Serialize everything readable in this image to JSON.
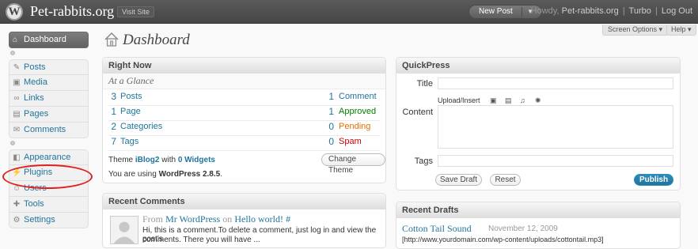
{
  "header": {
    "site_title": "Pet-rabbits.org",
    "visit_site": "Visit Site",
    "new_post": "New Post",
    "howdy": "Howdy,",
    "user": "Pet-rabbits.org",
    "turbo": "Turbo",
    "logout": "Log Out"
  },
  "screen_meta": {
    "screen_options": "Screen Options ▾",
    "help": "Help ▾"
  },
  "page_title": "Dashboard",
  "sidebar": {
    "dashboard": "Dashboard",
    "group1": [
      "Posts",
      "Media",
      "Links",
      "Pages",
      "Comments"
    ],
    "group2": [
      "Appearance",
      "Plugins",
      "Users",
      "Tools",
      "Settings"
    ]
  },
  "right_now": {
    "title": "Right Now",
    "subtitle": "At a Glance",
    "content": [
      {
        "num": "3",
        "label": "Posts"
      },
      {
        "num": "1",
        "label": "Page"
      },
      {
        "num": "2",
        "label": "Categories"
      },
      {
        "num": "7",
        "label": "Tags"
      }
    ],
    "discussion": [
      {
        "num": "1",
        "label": "Comment",
        "color": "#21759b"
      },
      {
        "num": "1",
        "label": "Approved",
        "color": "#008000"
      },
      {
        "num": "0",
        "label": "Pending",
        "color": "#e66f00"
      },
      {
        "num": "0",
        "label": "Spam",
        "color": "#cc0000"
      }
    ],
    "theme_prefix": "Theme",
    "theme_name": "iBlog2",
    "theme_with": "with",
    "widgets": "0 Widgets",
    "version_prefix": "You are using",
    "version": "WordPress 2.8.5",
    "version_suffix": ".",
    "change_theme": "Change Theme"
  },
  "recent_comments": {
    "title": "Recent Comments",
    "from": "From",
    "author": "Mr WordPress",
    "on": "on",
    "post": "Hello world!",
    "hash": "#",
    "text_line1": "Hi, this is a comment.To delete a comment, just log in and view the post's",
    "text_line2": "comments. There you will have ..."
  },
  "quickpress": {
    "title": "QuickPress",
    "title_label": "Title",
    "upload_insert": "Upload/Insert",
    "content_label": "Content",
    "tags_label": "Tags",
    "save_draft": "Save Draft",
    "reset": "Reset",
    "publish": "Publish"
  },
  "recent_drafts": {
    "title": "Recent Drafts",
    "draft_title": "Cotton Tail Sound",
    "draft_date": "November 12, 2009",
    "draft_excerpt": "[http://www.yourdomain.com/wp-content/uploads/cottontail.mp3]"
  },
  "colors": {
    "link": "#21759b",
    "annotation": "#e02020",
    "header": "#464646"
  }
}
